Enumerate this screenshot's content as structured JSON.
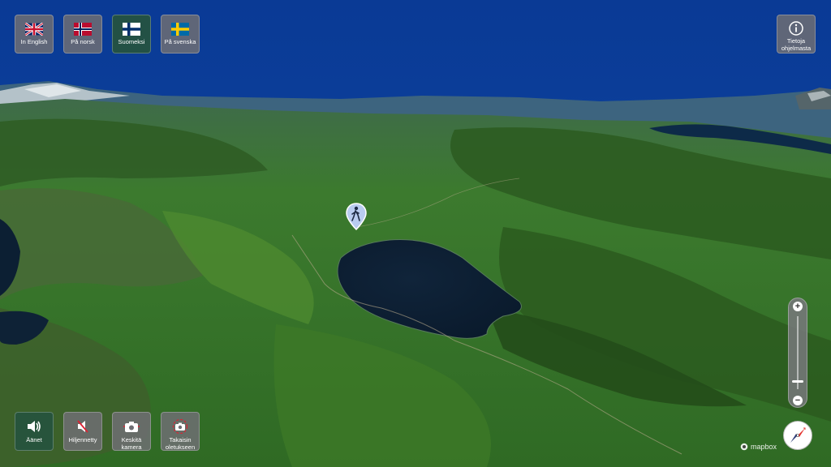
{
  "languages": [
    {
      "label": "In English",
      "flag": "uk",
      "active": false
    },
    {
      "label": "På norsk",
      "flag": "norway",
      "active": false
    },
    {
      "label": "Suomeksi",
      "flag": "finland",
      "active": true
    },
    {
      "label": "På svenska",
      "flag": "sweden",
      "active": false
    }
  ],
  "info_button": {
    "label": "Tietoja ohjelmasta"
  },
  "bottom_controls": [
    {
      "label": "Äänet",
      "icon": "speaker-on-icon",
      "active": true
    },
    {
      "label": "Hiljennetty",
      "icon": "speaker-muted-icon",
      "active": false
    },
    {
      "label": "Keskitä kamera",
      "icon": "camera-center-icon",
      "active": false
    },
    {
      "label": "Takaisin oletukseen",
      "icon": "camera-reset-icon",
      "active": false
    }
  ],
  "zoom": {
    "plus": "+",
    "minus": "−",
    "level_fraction": 0.12
  },
  "attribution": "mapbox",
  "colors": {
    "sky": "#0b3c97",
    "active": "#26543e",
    "button": "#6e6e73"
  }
}
